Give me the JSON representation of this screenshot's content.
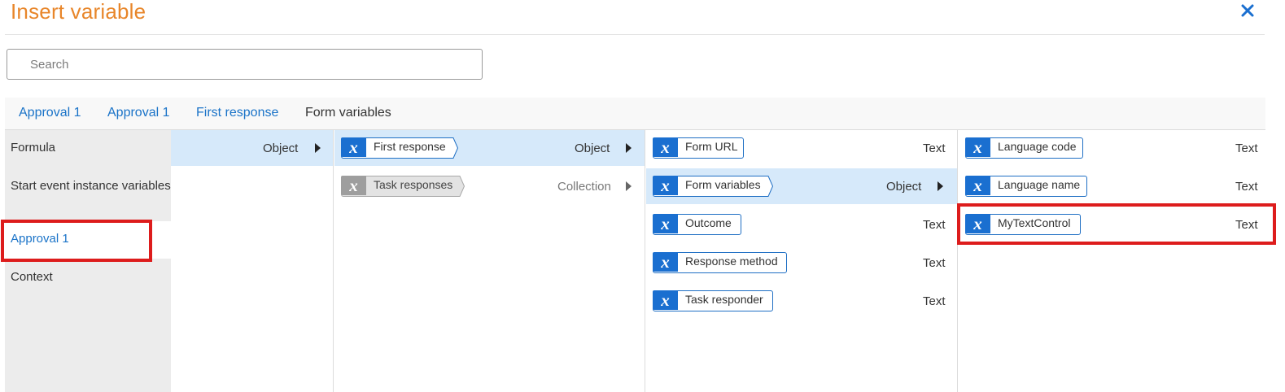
{
  "dialog": {
    "title": "Insert variable",
    "close_icon": "close-icon"
  },
  "search": {
    "placeholder": "Search",
    "value": ""
  },
  "breadcrumbs": [
    "Approval 1",
    "Approval 1",
    "First response",
    "Form variables"
  ],
  "nav": {
    "items": [
      "Formula",
      "Start event instance variables",
      "Approval 1",
      "Context"
    ],
    "selected": "Approval 1"
  },
  "col1": {
    "rows": [
      {
        "type": "Object",
        "selected": true
      }
    ]
  },
  "col2": {
    "rows": [
      {
        "name": "First response",
        "type": "Object",
        "selected": true,
        "style": "blue"
      },
      {
        "name": "Task responses",
        "type": "Collection",
        "selected": false,
        "style": "gray"
      }
    ]
  },
  "col3": {
    "rows": [
      {
        "name": "Form URL",
        "type": "Text"
      },
      {
        "name": "Form variables",
        "type": "Object",
        "selected": true
      },
      {
        "name": "Outcome",
        "type": "Text"
      },
      {
        "name": "Response method",
        "type": "Text"
      },
      {
        "name": "Task responder",
        "type": "Text"
      }
    ]
  },
  "col4": {
    "rows": [
      {
        "name": "Language code",
        "type": "Text"
      },
      {
        "name": "Language name",
        "type": "Text"
      },
      {
        "name": "MyTextControl",
        "type": "Text",
        "highlighted": true
      }
    ]
  },
  "variable_glyph": "x",
  "colors": {
    "title": "#e8862a",
    "link": "#1a73c8",
    "chip_blue": "#1a6fd0",
    "chip_gray": "#9e9e9e",
    "selected_row": "#d6e9fa",
    "highlight_box": "#dd1c1c"
  }
}
